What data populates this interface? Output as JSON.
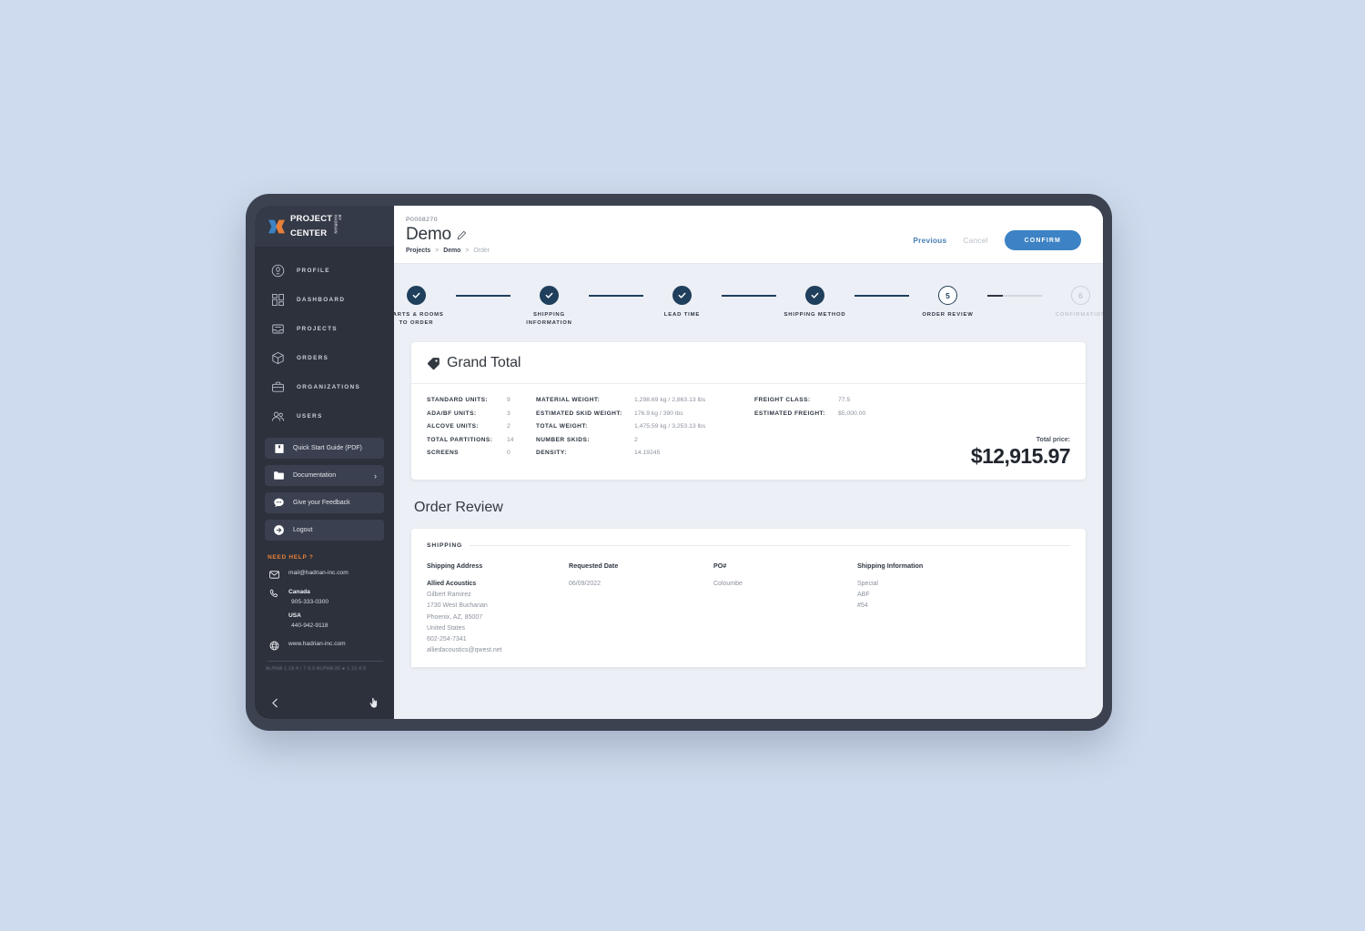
{
  "brand": {
    "logo_line1": "PROJECT",
    "logo_line2": "CENTER",
    "logo_sup": "BY HADRIAN",
    "accent_orange": "#e8803a",
    "accent_blue": "#3c82c4",
    "navy": "#1f3f5c"
  },
  "sidebar": {
    "nav": [
      {
        "icon": "profile-icon",
        "label": "PROFILE"
      },
      {
        "icon": "dashboard-grid-icon",
        "label": "DASHBOARD"
      },
      {
        "icon": "projects-drawer-icon",
        "label": "PROJECTS"
      },
      {
        "icon": "orders-box-icon",
        "label": "ORDERS"
      },
      {
        "icon": "organizations-briefcase-icon",
        "label": "ORGANIZATIONS"
      },
      {
        "icon": "users-icon",
        "label": "USERS"
      }
    ],
    "quick_buttons": [
      {
        "icon": "book-icon",
        "label": "Quick Start Guide (PDF)",
        "chevron": ""
      },
      {
        "icon": "folder-icon",
        "label": "Documentation",
        "chevron": "›"
      },
      {
        "icon": "chat-icon",
        "label": "Give your Feedback",
        "chevron": ""
      },
      {
        "icon": "logout-arrow-icon",
        "label": "Logout",
        "chevron": ""
      }
    ],
    "help": {
      "title": "NEED HELP ?",
      "email": "mail@hadrian-inc.com",
      "canada_label": "Canada",
      "canada_phone": "905-333-0300",
      "usa_label": "USA",
      "usa_phone": "440-942-9118",
      "website": "www.hadrian-inc.com",
      "fineprint": "ALPHA 1.19.4 | 7.4.0  ALPHA 00 ● 1.12.4.0"
    },
    "footer": {
      "collapse_icon": "chevron-left-icon",
      "cursor_icon": "pointer-icon"
    }
  },
  "header": {
    "project_id": "P0008270",
    "title": "Demo",
    "edit_icon": "pencil-icon",
    "breadcrumb": [
      {
        "label": "Projects",
        "dim": false
      },
      {
        "label": ">",
        "sep": true
      },
      {
        "label": "Demo",
        "dim": false
      },
      {
        "label": ">",
        "sep": true
      },
      {
        "label": "Order",
        "dim": true
      }
    ],
    "previous_label": "Previous",
    "cancel_label": "Cancel",
    "confirm_label": "CONFIRM"
  },
  "stepper": {
    "steps": [
      {
        "num": "1",
        "state": "done",
        "label": "PARTS & ROOMS\nTO ORDER"
      },
      {
        "num": "2",
        "state": "done",
        "label": "SHIPPING\nINFORMATION"
      },
      {
        "num": "3",
        "state": "done",
        "label": "LEAD TIME"
      },
      {
        "num": "4",
        "state": "done",
        "label": "SHIPPING METHOD"
      },
      {
        "num": "5",
        "state": "current",
        "label": "ORDER REVIEW"
      },
      {
        "num": "6",
        "state": "todo",
        "label": "CONFIRMATION"
      }
    ]
  },
  "grand_total": {
    "icon": "price-tag-icon",
    "heading": "Grand Total",
    "col1": [
      {
        "key": "STANDARD UNITS:",
        "value": "9"
      },
      {
        "key": "ADA/BF UNITS:",
        "value": "3"
      },
      {
        "key": "ALCOVE UNITS:",
        "value": "2"
      },
      {
        "key": "TOTAL PARTITIONS:",
        "value": "14"
      },
      {
        "key": "SCREENS",
        "value": "0"
      }
    ],
    "col2": [
      {
        "key": "MATERIAL WEIGHT:",
        "value": "1,298.69 kg / 2,863.13 lbs"
      },
      {
        "key": "ESTIMATED SKID WEIGHT:",
        "value": "176.9 kg / 390 lbs"
      },
      {
        "key": "TOTAL WEIGHT:",
        "value": "1,475.59 kg / 3,253.13 lbs"
      },
      {
        "key": "NUMBER SKIDS:",
        "value": "2"
      },
      {
        "key": "DENSITY:",
        "value": "14.19245"
      }
    ],
    "col3": [
      {
        "key": "FREIGHT CLASS:",
        "value": "77.5"
      },
      {
        "key": "ESTIMATED FREIGHT:",
        "value": "$5,000.00"
      }
    ],
    "total_label": "Total price:",
    "total_value": "$12,915.97"
  },
  "order_review": {
    "section_title": "Order Review",
    "shipping_label": "SHIPPING",
    "columns": [
      {
        "header": "Shipping Address"
      },
      {
        "header": "Requested Date"
      },
      {
        "header": "PO#"
      },
      {
        "header": "Shipping Information"
      }
    ],
    "shipping_address": {
      "company": "Allied Acoustics",
      "lines": [
        "Gilbert Ramirez",
        "1730 West Buchanan",
        "Phoenix, AZ, 85007",
        "United States",
        "602-254-7341",
        "alliedacoustics@qwest.net"
      ]
    },
    "requested_date": "06/09/2022",
    "po_number": "Coloumbe",
    "shipping_information": [
      "Special",
      "ABF",
      "#54"
    ]
  }
}
